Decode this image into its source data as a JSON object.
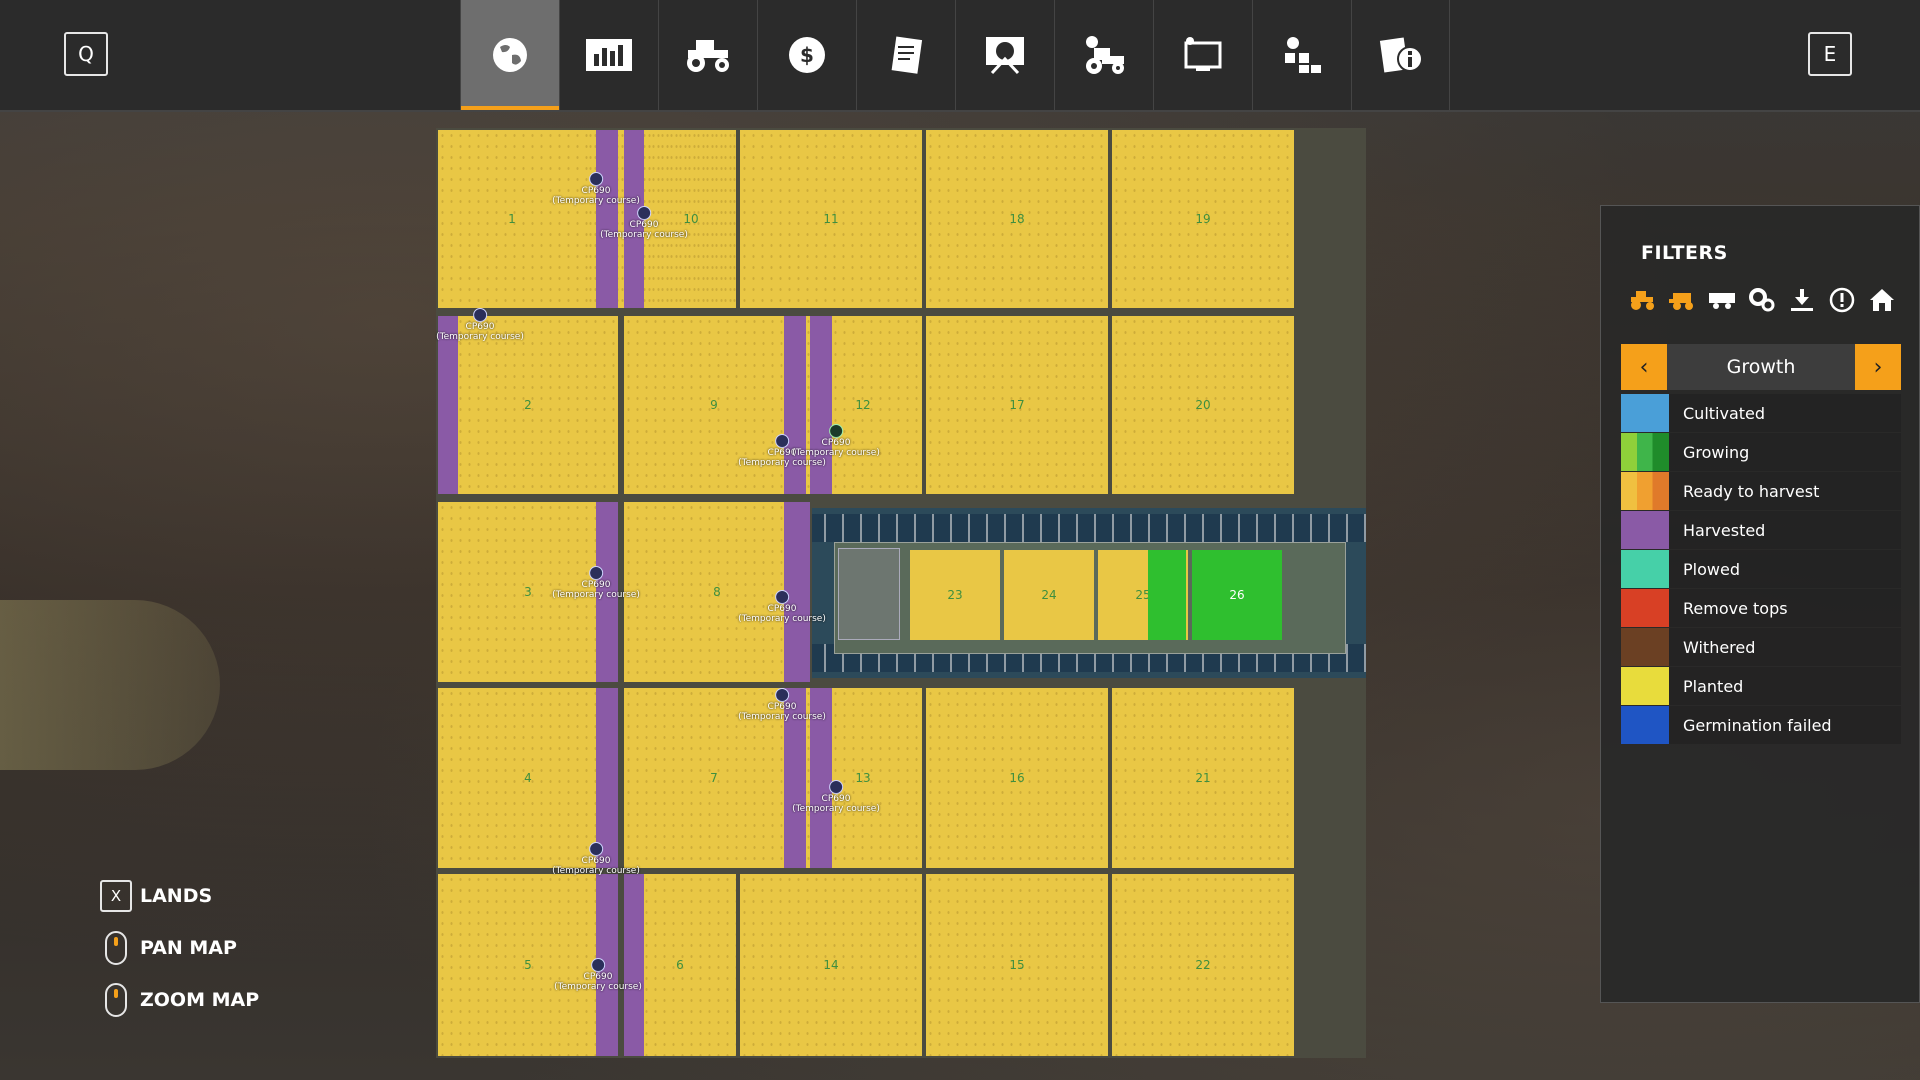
{
  "topbar": {
    "left_key": "Q",
    "right_key": "E",
    "tabs": [
      {
        "icon": "globe-map-icon",
        "active": true
      },
      {
        "icon": "statistics-chart-icon",
        "active": false
      },
      {
        "icon": "tractor-icon",
        "active": false
      },
      {
        "icon": "dollar-finance-icon",
        "active": false
      },
      {
        "icon": "contracts-icon",
        "active": false
      },
      {
        "icon": "animals-icon",
        "active": false
      },
      {
        "icon": "workers-tractor-icon",
        "active": false
      },
      {
        "icon": "production-screen-icon",
        "active": false
      },
      {
        "icon": "settings-blocks-icon",
        "active": false
      },
      {
        "icon": "help-info-icon",
        "active": false
      }
    ]
  },
  "map": {
    "fields": [
      "1",
      "10",
      "11",
      "18",
      "19",
      "2",
      "9",
      "12",
      "17",
      "20",
      "3",
      "8",
      "4",
      "7",
      "13",
      "16",
      "21",
      "5",
      "6",
      "14",
      "15",
      "22"
    ],
    "farm_fields": [
      "23",
      "24",
      "25",
      "26"
    ],
    "marker_label": "CP690",
    "marker_sublabel": "(Temporary course)"
  },
  "filters": {
    "title": "FILTERS",
    "icons": [
      "tractor-filter-icon",
      "harvester-filter-icon",
      "trailer-filter-icon",
      "tools-filter-icon",
      "sell-point-icon",
      "warning-icon",
      "farmhouse-icon"
    ],
    "selector_value": "Growth",
    "legend": [
      {
        "label": "Cultivated",
        "color": "#4a9fd8"
      },
      {
        "label": "Growing",
        "color": "#3fb54a"
      },
      {
        "label": "Ready to harvest",
        "color": "#f0a030"
      },
      {
        "label": "Harvested",
        "color": "#8a5aa6"
      },
      {
        "label": "Plowed",
        "color": "#46d0a8"
      },
      {
        "label": "Remove tops",
        "color": "#d84025"
      },
      {
        "label": "Withered",
        "color": "#6b4023"
      },
      {
        "label": "Planted",
        "color": "#e8dc3c"
      },
      {
        "label": "Germination failed",
        "color": "#1f55c4"
      }
    ]
  },
  "controls": [
    {
      "key": "X",
      "label": "LANDS"
    },
    {
      "key": "",
      "label": "PAN MAP"
    },
    {
      "key": "",
      "label": "ZOOM MAP"
    }
  ]
}
